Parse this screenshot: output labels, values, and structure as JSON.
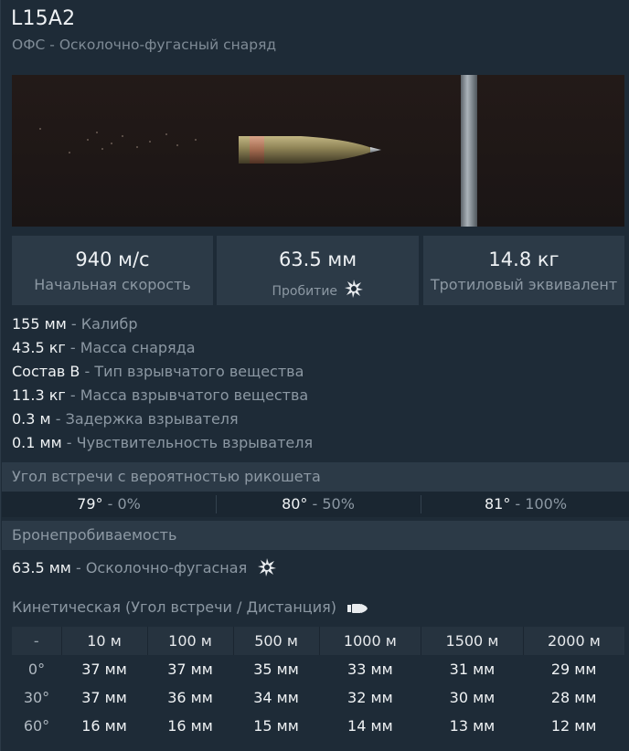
{
  "header": {
    "title": "L15A2",
    "subtitle": "ОФС - Осколочно-фугасный снаряд"
  },
  "stats": [
    {
      "value": "940 м/с",
      "label": "Начальная скорость"
    },
    {
      "value": "63.5 мм",
      "label": "Пробитие",
      "icon": "explosion-icon"
    },
    {
      "value": "14.8 кг",
      "label": "Тротиловый эквивалент"
    }
  ],
  "properties": [
    {
      "value": "155 мм",
      "name": "Калибр"
    },
    {
      "value": "43.5 кг",
      "name": "Масса снаряда"
    },
    {
      "value": "Состав B",
      "name": "Тип взрывчатого вещества"
    },
    {
      "value": "11.3 кг",
      "name": "Масса взрывчатого вещества"
    },
    {
      "value": "0.3 м",
      "name": "Задержка взрывателя"
    },
    {
      "value": "0.1 мм",
      "name": "Чувствительность взрывателя"
    }
  ],
  "separator": " - ",
  "ricochet": {
    "header": "Угол встречи с вероятностью рикошета",
    "items": [
      {
        "angle": "79°",
        "chance": "0%"
      },
      {
        "angle": "80°",
        "chance": "50%"
      },
      {
        "angle": "81°",
        "chance": "100%"
      }
    ]
  },
  "penetration": {
    "header": "Бронепробиваемость",
    "he": {
      "value": "63.5 мм",
      "name": "Осколочно-фугасная",
      "icon": "explosion-icon"
    },
    "kinetic_title": "Кинетическая (Угол встречи / Дистанция)",
    "kinetic_icon": "shell-icon",
    "table": {
      "corner": "-",
      "columns": [
        "10 м",
        "100 м",
        "500 м",
        "1000 м",
        "1500 м",
        "2000 м"
      ],
      "rows": [
        {
          "angle": "0°",
          "values": [
            "37 мм",
            "37 мм",
            "35 мм",
            "33 мм",
            "31 мм",
            "29 мм"
          ]
        },
        {
          "angle": "30°",
          "values": [
            "37 мм",
            "36 мм",
            "34 мм",
            "32 мм",
            "30 мм",
            "28 мм"
          ]
        },
        {
          "angle": "60°",
          "values": [
            "16 мм",
            "16 мм",
            "15 мм",
            "14 мм",
            "13 мм",
            "12 мм"
          ]
        }
      ]
    }
  }
}
